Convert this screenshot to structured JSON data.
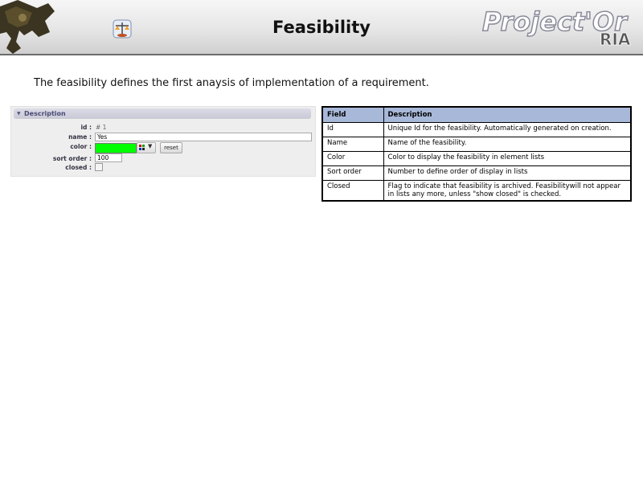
{
  "header": {
    "title": "Feasibility",
    "brand": {
      "main": "Project'Or",
      "sub": "RIA"
    }
  },
  "intro": "The feasibility defines the first anaysis of implementation of a requirement.",
  "form": {
    "section_title": "Description",
    "id_label": "id :",
    "id_value": "# 1",
    "name_label": "name :",
    "name_value": "Yes",
    "color_label": "color :",
    "color_value": "#00ff00",
    "reset_label": "reset",
    "sort_label": "sort order :",
    "sort_value": "100",
    "closed_label": "closed :",
    "closed_checked": false
  },
  "table": {
    "headers": [
      "Field",
      "Description"
    ],
    "rows": [
      [
        "Id",
        "Unique Id for the feasibility. Automatically generated on creation."
      ],
      [
        "Name",
        "Name of the feasibility."
      ],
      [
        "Color",
        "Color to display the feasibility in element lists"
      ],
      [
        "Sort order",
        "Number to define order of display in lists"
      ],
      [
        "Closed",
        "Flag to indicate that feasibility is archived. Feasibilitywill not appear in lists any more, unless \"show closed\" is checked."
      ]
    ]
  },
  "colors": {
    "table_header": "#a8b8d8",
    "panel_bg": "#eeeeee",
    "accent_green": "#00ff00"
  },
  "icons": [
    "camera-logo-icon",
    "feasibility-scale-icon",
    "color-grid-icon",
    "chevron-down-icon",
    "collapse-triangle-icon"
  ]
}
